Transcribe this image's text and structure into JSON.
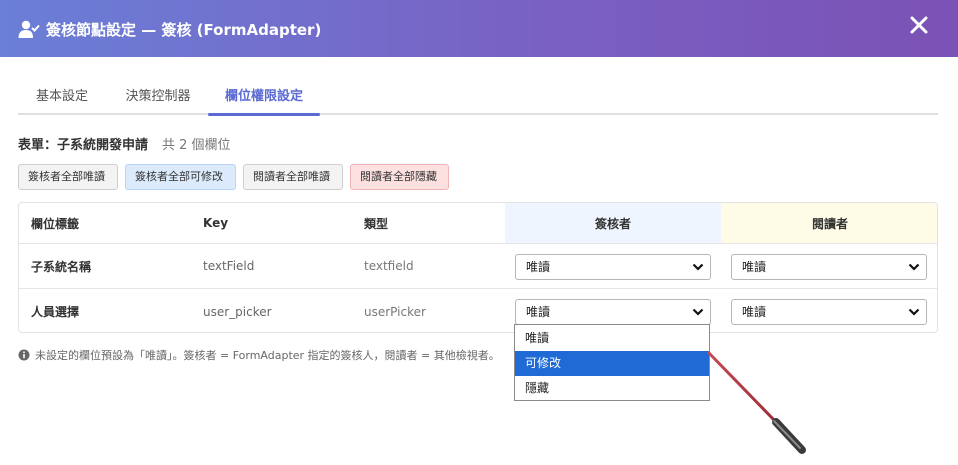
{
  "header": {
    "title": "簽核節點設定 — 簽核 (FormAdapter)",
    "icon": "user-check-icon",
    "close_icon": "close-icon"
  },
  "tabs": [
    {
      "label": "基本設定",
      "active": false
    },
    {
      "label": "決策控制器",
      "active": false
    },
    {
      "label": "欄位權限設定",
      "active": true
    }
  ],
  "form": {
    "label": "表單：子系統開發申請",
    "count": "共 2 個欄位"
  },
  "preset_buttons": {
    "approver_all_read": "簽核者全部唯讀",
    "approver_all_edit": "簽核者全部可修改",
    "reader_all_read": "閱讀者全部唯讀",
    "reader_all_hidden": "閱讀者全部隱藏"
  },
  "table": {
    "headers": {
      "label": "欄位標籤",
      "key": "Key",
      "type": "類型",
      "approver": "簽核者",
      "reader": "閱讀者"
    },
    "rows": [
      {
        "label": "子系統名稱",
        "key": "textField",
        "type": "textfield",
        "approver": "唯讀",
        "reader": "唯讀"
      },
      {
        "label": "人員選擇",
        "key": "user_picker",
        "type": "userPicker",
        "approver": "唯讀",
        "reader": "唯讀"
      }
    ]
  },
  "dropdown": {
    "options": [
      "唯讀",
      "可修改",
      "隱藏"
    ],
    "highlighted": "可修改"
  },
  "note": "未設定的欄位預設為「唯讀」。簽核者 = FormAdapter 指定的簽核人，閱讀者 = 其他檢視者。",
  "colors": {
    "header_start": "#6a7fd6",
    "header_end": "#7b52b5",
    "accent": "#5b6bd1",
    "option_highlight": "#1f6ad4"
  }
}
